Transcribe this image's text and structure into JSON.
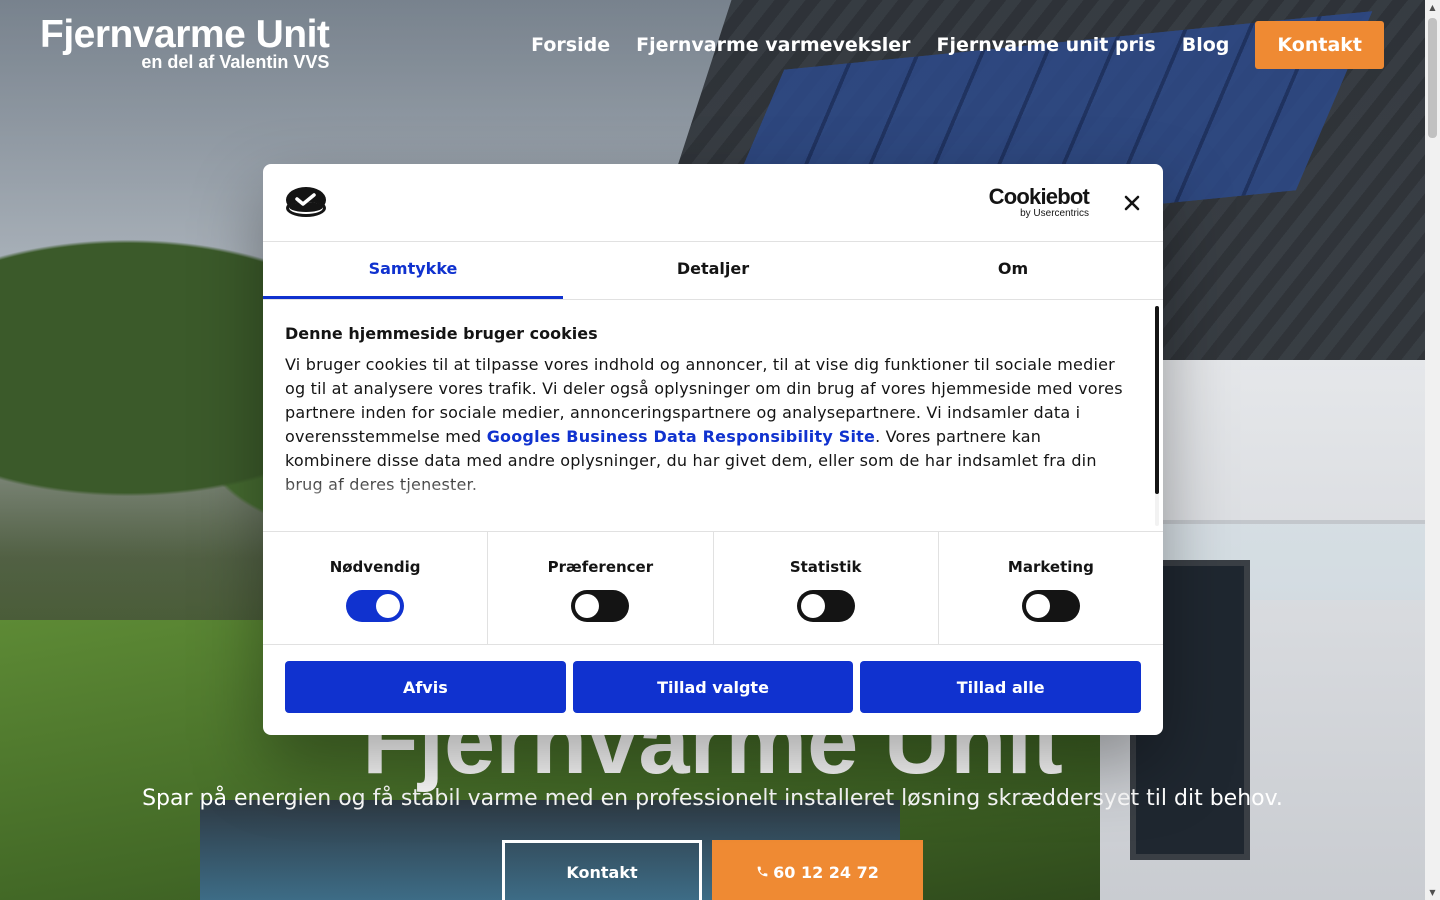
{
  "site": {
    "logo_title": "Fjernvarme Unit",
    "logo_subtitle": "en del af Valentin VVS",
    "nav": [
      {
        "label": "Forside"
      },
      {
        "label": "Fjernvarme varmeveksler"
      },
      {
        "label": "Fjernvarme unit pris"
      },
      {
        "label": "Blog"
      }
    ],
    "nav_cta": "Kontakt"
  },
  "hero": {
    "title": "Fjernvarme Unit",
    "subtitle": "Spar på energien og få stabil varme med en professionelt installeret løsning skræddersyet til dit behov.",
    "button_outline": "Kontakt",
    "button_phone": "60 12 24 72",
    "phone_icon": "phone-icon"
  },
  "cookie_dialog": {
    "brand_name": "Cookiebot",
    "brand_by": "by Usercentrics",
    "tabs": [
      {
        "label": "Samtykke",
        "active": true
      },
      {
        "label": "Detaljer",
        "active": false
      },
      {
        "label": "Om",
        "active": false
      }
    ],
    "heading": "Denne hjemmeside bruger cookies",
    "text_before_link": "Vi bruger cookies til at tilpasse vores indhold og annoncer, til at vise dig funktioner til sociale medier og til at analysere vores trafik. Vi deler også oplysninger om din brug af vores hjemmeside med vores partnere inden for sociale medier, annonceringspartnere og analysepartnere. Vi indsamler data i overensstemmelse med ",
    "link_text": "Googles Business Data Responsibility Site",
    "text_after_link": ". Vores partnere kan kombinere disse data med andre oplysninger, du har givet dem, eller som de har indsamlet fra din brug af deres tjenester.",
    "toggles": [
      {
        "label": "Nødvendig",
        "checked": true
      },
      {
        "label": "Præferencer",
        "checked": false
      },
      {
        "label": "Statistik",
        "checked": false
      },
      {
        "label": "Marketing",
        "checked": false
      }
    ],
    "buttons": {
      "reject": "Afvis",
      "allow_selected": "Tillad valgte",
      "allow_all": "Tillad alle"
    }
  },
  "colors": {
    "accent_orange": "#ef8a33",
    "cookiebot_blue": "#1032cf",
    "text_dark": "#141414"
  }
}
